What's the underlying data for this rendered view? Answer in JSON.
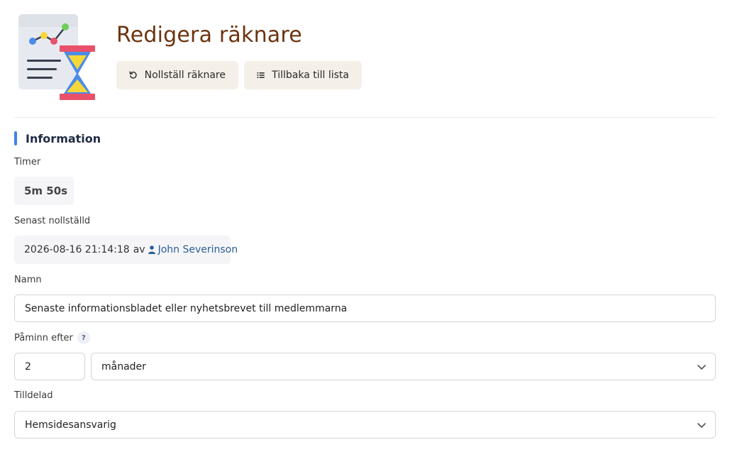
{
  "page": {
    "title": "Redigera räknare"
  },
  "toolbar": {
    "reset_label": "Nollställ räknare",
    "back_label": "Tillbaka till lista"
  },
  "section": {
    "title": "Information"
  },
  "fields": {
    "timer": {
      "label": "Timer",
      "value": "5m 50s"
    },
    "last_reset": {
      "label": "Senast nollställd",
      "datetime": "2026-08-16 21:14:18",
      "by_word": "av",
      "user": "John Severinson"
    },
    "name": {
      "label": "Namn",
      "value": "Senaste informationsbladet eller nyhetsbrevet till medlemmarna"
    },
    "remind_after": {
      "label": "Påminn efter",
      "help": "?",
      "amount": "2",
      "unit": "månader"
    },
    "assigned": {
      "label": "Tilldelad",
      "value": "Hemsidesansvarig"
    }
  },
  "colors": {
    "title": "#6b3410",
    "accent": "#3d86e6",
    "button_bg": "#f4efe9",
    "link": "#2b5f95"
  },
  "icons": {
    "logo": "timer-hourglass-chart-icon",
    "reset": "undo-icon",
    "back": "list-icon",
    "user": "user-icon",
    "dropdown": "chevron-down-icon"
  }
}
